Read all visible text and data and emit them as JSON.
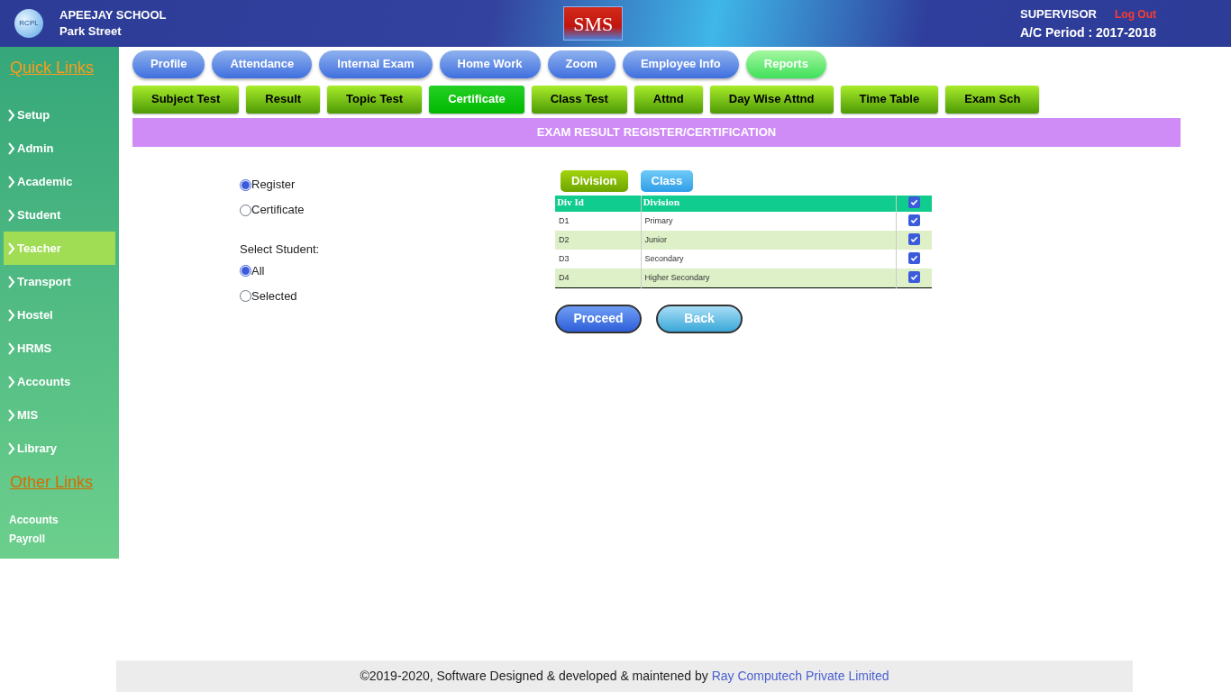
{
  "header": {
    "logo_text": "RCPL",
    "school": "APEEJAY SCHOOL",
    "branch": "Park Street",
    "badge": "SMS",
    "role": "SUPERVISOR",
    "logout": "Log Out",
    "period": "A/C Period : 2017-2018"
  },
  "sidebar": {
    "title": "Quick Links",
    "items": [
      {
        "label": "Setup",
        "selected": false
      },
      {
        "label": "Admin",
        "selected": false
      },
      {
        "label": "Academic",
        "selected": false
      },
      {
        "label": "Student",
        "selected": false
      },
      {
        "label": "Teacher",
        "selected": true
      },
      {
        "label": "Transport",
        "selected": false
      },
      {
        "label": "Hostel",
        "selected": false
      },
      {
        "label": "HRMS",
        "selected": false
      },
      {
        "label": "Accounts",
        "selected": false
      },
      {
        "label": "MIS",
        "selected": false
      },
      {
        "label": "Library",
        "selected": false
      }
    ],
    "other_title": "Other Links",
    "other_items": [
      "Accounts",
      "Payroll"
    ]
  },
  "menu_tabs": [
    {
      "label": "Profile",
      "selected": false
    },
    {
      "label": "Attendance",
      "selected": false
    },
    {
      "label": "Internal Exam",
      "selected": false
    },
    {
      "label": "Home Work",
      "selected": false
    },
    {
      "label": "Zoom",
      "selected": false
    },
    {
      "label": "Employee Info",
      "selected": false
    },
    {
      "label": "Reports",
      "selected": true
    }
  ],
  "sub_tabs": [
    {
      "label": "Subject Test",
      "selected": false
    },
    {
      "label": "Result",
      "selected": false
    },
    {
      "label": "Topic Test",
      "selected": false
    },
    {
      "label": "Certificate",
      "selected": true
    },
    {
      "label": "Class Test",
      "selected": false
    },
    {
      "label": "Attnd",
      "selected": false
    },
    {
      "label": "Day Wise Attnd",
      "selected": false
    },
    {
      "label": "Time Table",
      "selected": false
    },
    {
      "label": "Exam Sch",
      "selected": false
    }
  ],
  "page_title": "EXAM RESULT REGISTER/CERTIFICATION",
  "report_type": [
    {
      "label": "Register",
      "selected": true
    },
    {
      "label": "Certificate",
      "selected": false
    }
  ],
  "select_student_label": "Select Student:",
  "student_scope": [
    {
      "label": "All",
      "selected": true
    },
    {
      "label": "Selected",
      "selected": false
    }
  ],
  "filter_tabs": [
    {
      "label": "Division",
      "selected": true
    },
    {
      "label": "Class",
      "selected": false
    }
  ],
  "table": {
    "columns": [
      "Div Id",
      "Division"
    ],
    "all_checked": true,
    "rows": [
      {
        "id": "D1",
        "name": "Primary",
        "checked": true
      },
      {
        "id": "D2",
        "name": "Junior",
        "checked": true
      },
      {
        "id": "D3",
        "name": "Secondary",
        "checked": true
      },
      {
        "id": "D4",
        "name": "Higher Secondary",
        "checked": true
      }
    ]
  },
  "buttons": [
    "Proceed",
    "Back"
  ],
  "footer": {
    "text": "©2019-2020, Software Designed & developed & maintened by",
    "link": "Ray Computech Private Limited"
  }
}
